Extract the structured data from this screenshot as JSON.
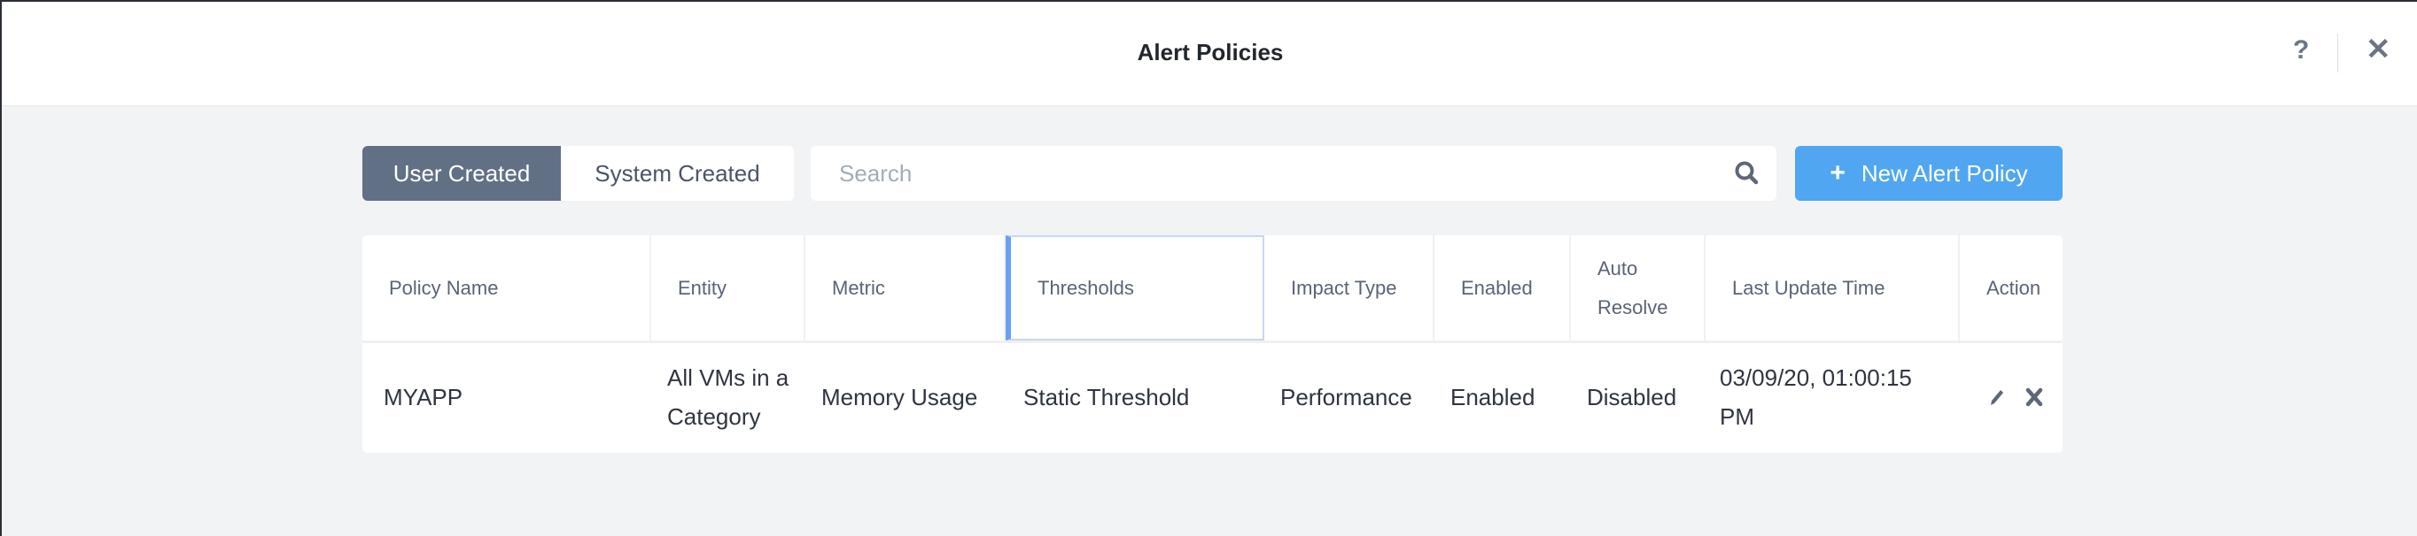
{
  "header": {
    "title": "Alert Policies",
    "help_label": "?",
    "close_label": "✕"
  },
  "toolbar": {
    "tabs": [
      {
        "label": "User Created",
        "selected": true
      },
      {
        "label": "System Created",
        "selected": false
      }
    ],
    "search_placeholder": "Search",
    "new_button_label": "New Alert Policy",
    "new_button_icon": "+"
  },
  "colors": {
    "accent": "#50a6f1",
    "tab_selected": "#627085"
  },
  "table": {
    "columns": [
      "Policy Name",
      "Entity",
      "Metric",
      "Thresholds",
      "Impact Type",
      "Enabled",
      "Auto Resolve",
      "Last Update Time",
      "Action"
    ],
    "rows": [
      {
        "policy_name": "MYAPP",
        "entity": "All VMs in a Category",
        "metric": "Memory Usage",
        "thresholds": "Static Threshold",
        "impact_type": "Performance",
        "enabled": "Enabled",
        "auto_resolve": "Disabled",
        "last_update": "03/09/20, 01:00:15 PM",
        "actions": [
          "edit-icon",
          "delete-icon"
        ]
      }
    ]
  }
}
